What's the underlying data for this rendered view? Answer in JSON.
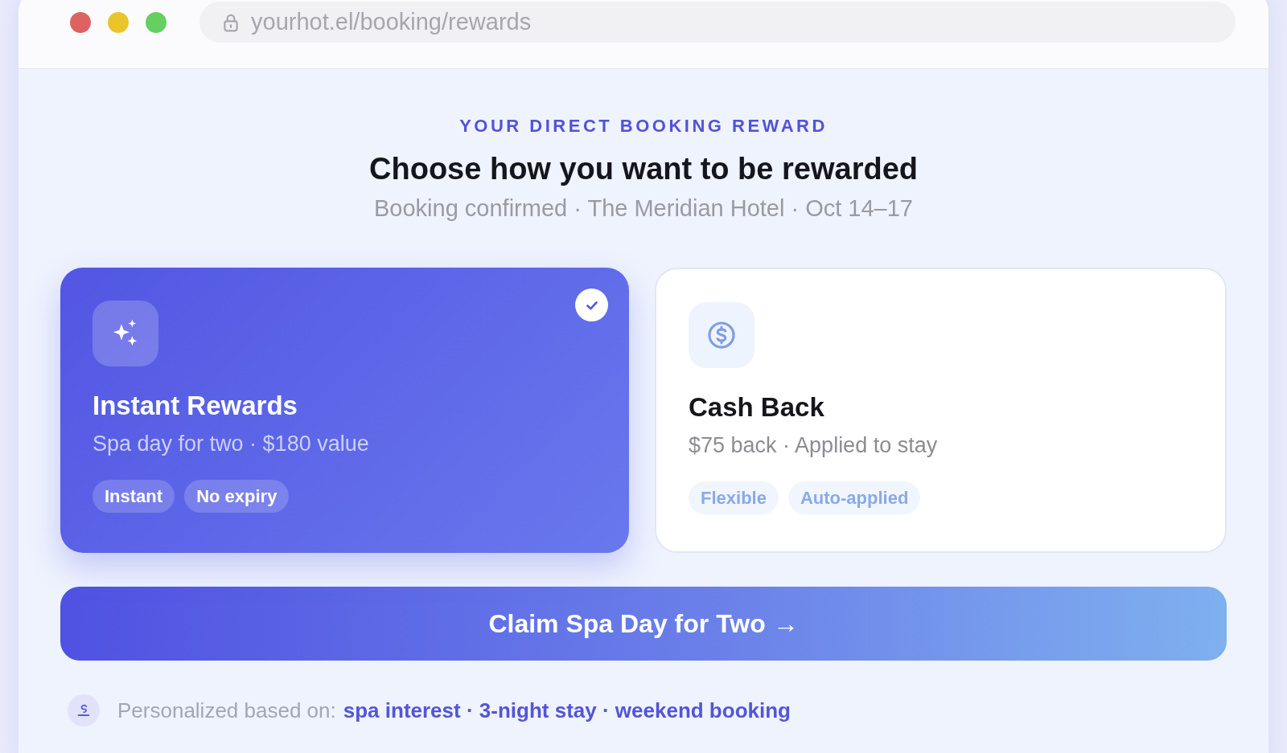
{
  "browser": {
    "url": "yourhot.el/booking/rewards"
  },
  "header": {
    "eyebrow": "YOUR DIRECT BOOKING REWARD",
    "title": "Choose how you want to be rewarded",
    "subtitle": "Booking confirmed · The Meridian Hotel · Oct 14–17"
  },
  "options": [
    {
      "title": "Instant Rewards",
      "detail": "Spa day for two · $180 value",
      "tags": [
        "Instant",
        "No expiry"
      ],
      "selected": true
    },
    {
      "title": "Cash Back",
      "detail": "$75 back · Applied to stay",
      "tags": [
        "Flexible",
        "Auto-applied"
      ],
      "selected": false
    }
  ],
  "cta": {
    "label": "Claim Spa Day for Two →"
  },
  "footer": {
    "label": "Personalized based on:",
    "factors": "spa interest · 3-night stay · weekend booking"
  }
}
